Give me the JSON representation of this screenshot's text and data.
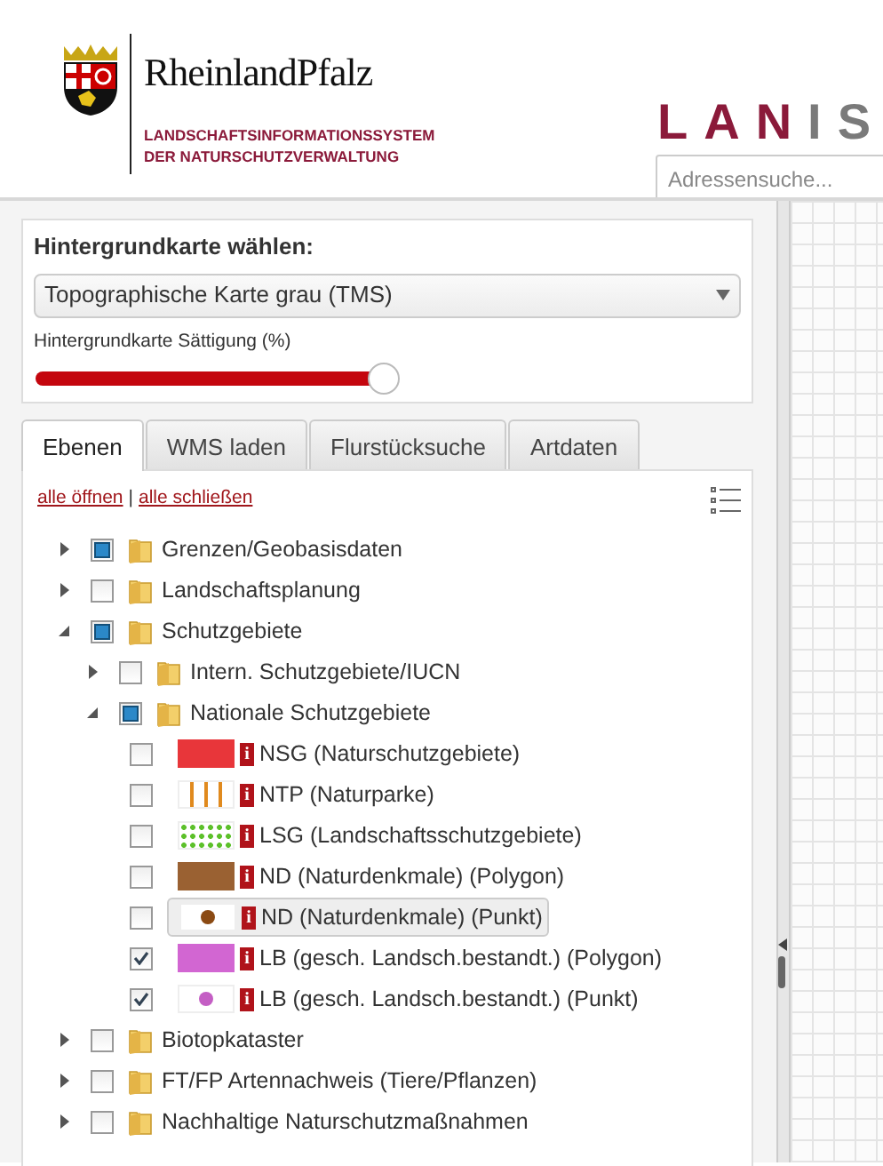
{
  "header": {
    "state_name": "RheinlandPfalz",
    "subtitle_lines": [
      "LANDSCHAFTSINFORMATIONSSYSTEM",
      "DER NATURSCHUTZVERWALTUNG"
    ],
    "app_name_parts": [
      {
        "text": "LAN",
        "color": "#8b1a3a"
      },
      {
        "text": "IS",
        "color": "#7a7a7a"
      }
    ],
    "search": {
      "placeholder": "Adressensuche..."
    }
  },
  "basemap": {
    "label": "Hintergrundkarte wählen:",
    "value": "Topographische Karte grau (TMS)",
    "saturation_label": "Hintergrundkarte Sättigung (%)",
    "level": 0.5
  },
  "tabs": [
    {
      "label": "Ebenen",
      "selected": true
    },
    {
      "label": "WMS laden",
      "selected": false
    },
    {
      "label": "Flurstücksuche",
      "selected": false
    },
    {
      "label": "Artdaten",
      "selected": false
    }
  ],
  "tree_links": [
    {
      "text": "alle öffnen"
    },
    {
      "text": "|"
    },
    {
      "text": "alle schließen"
    }
  ],
  "tree": [
    {
      "kind": "folder",
      "label": "Grenzen/Geobasisdaten",
      "expanded": false,
      "partial": true
    },
    {
      "kind": "folder",
      "label": "Landschaftsplanung",
      "expanded": false,
      "partial": false
    },
    {
      "kind": "folder",
      "label": "Schutzgebiete",
      "expanded": true,
      "partial": true,
      "children": [
        {
          "kind": "folder",
          "label": "Intern. Schutzgebiete/IUCN",
          "expanded": false,
          "partial": false
        },
        {
          "kind": "folder",
          "label": "Nationale Schutzgebiete",
          "expanded": true,
          "partial": true,
          "children": [
            {
              "kind": "layer",
              "label": "NSG (Naturschutzgebiete)",
              "info": "i",
              "checked": false,
              "highlighted": false,
              "legend": {
                "kind": "fill",
                "color": "#e8363a"
              }
            },
            {
              "kind": "layer",
              "label": "NTP (Naturparke)",
              "info": "i",
              "checked": false,
              "highlighted": false,
              "legend": {
                "kind": "stripes",
                "color": "#e08a1e"
              }
            },
            {
              "kind": "layer",
              "label": "LSG (Landschaftsschutzgebiete)",
              "info": "i",
              "checked": false,
              "highlighted": false,
              "legend": {
                "kind": "dots",
                "color": "#5cc02a"
              }
            },
            {
              "kind": "layer",
              "label": "ND (Naturdenkmale) (Polygon)",
              "info": "i",
              "checked": false,
              "highlighted": false,
              "legend": {
                "kind": "fill",
                "color": "#9a6132"
              }
            },
            {
              "kind": "layer",
              "label": "ND (Naturdenkmale) (Punkt)",
              "info": "i",
              "checked": false,
              "highlighted": true,
              "legend": {
                "kind": "point",
                "color": "#8b4a13"
              }
            },
            {
              "kind": "layer",
              "label": "LB (gesch. Landsch.bestandt.) (Polygon)",
              "info": "i",
              "checked": true,
              "highlighted": false,
              "legend": {
                "kind": "fill",
                "color": "#d266d2"
              }
            },
            {
              "kind": "layer",
              "label": "LB (gesch. Landsch.bestandt.) (Punkt)",
              "info": "i",
              "checked": true,
              "highlighted": false,
              "legend": {
                "kind": "point",
                "color": "#c45ec4"
              }
            }
          ]
        }
      ]
    },
    {
      "kind": "folder",
      "label": "Biotopkataster",
      "expanded": false,
      "partial": false
    },
    {
      "kind": "folder",
      "label": "FT/FP Artennachweis (Tiere/Pflanzen)",
      "expanded": false,
      "partial": false
    },
    {
      "kind": "folder",
      "label": "Nachhaltige Naturschutzmaßnahmen",
      "expanded": false,
      "partial": false
    }
  ]
}
